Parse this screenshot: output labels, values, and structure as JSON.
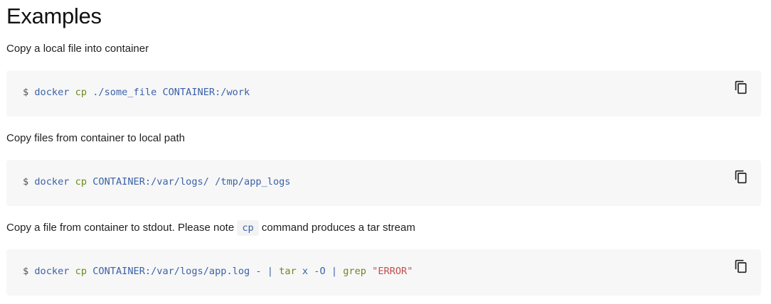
{
  "page": {
    "title": "Examples"
  },
  "examples": [
    {
      "description": "Copy a local file into container",
      "prompt": "$",
      "tokens": [
        {
          "text": "docker",
          "cls": "cmd"
        },
        {
          "text": "cp",
          "cls": "green"
        },
        {
          "text": "./some_file CONTAINER:/work",
          "cls": "cmd"
        }
      ]
    },
    {
      "description": "Copy files from container to local path",
      "prompt": "$",
      "tokens": [
        {
          "text": "docker",
          "cls": "cmd"
        },
        {
          "text": "cp",
          "cls": "green"
        },
        {
          "text": "CONTAINER:/var/logs/ /tmp/app_logs",
          "cls": "cmd"
        }
      ]
    },
    {
      "description_before": "Copy a file from container to stdout. Please note",
      "description_code": "cp",
      "description_after": "command produces a tar stream",
      "prompt": "$",
      "tokens": [
        {
          "text": "docker",
          "cls": "cmd"
        },
        {
          "text": "cp",
          "cls": "green"
        },
        {
          "text": "CONTAINER:/var/logs/app.log - |",
          "cls": "cmd"
        },
        {
          "text": "tar",
          "cls": "green"
        },
        {
          "text": "x",
          "cls": "cmd"
        },
        {
          "text": "-O",
          "cls": "cmd"
        },
        {
          "text": "|",
          "cls": "cmd"
        },
        {
          "text": "grep",
          "cls": "green"
        },
        {
          "text": "\"ERROR\"",
          "cls": "str"
        }
      ]
    }
  ],
  "icons": {
    "copy": "copy-icon"
  }
}
